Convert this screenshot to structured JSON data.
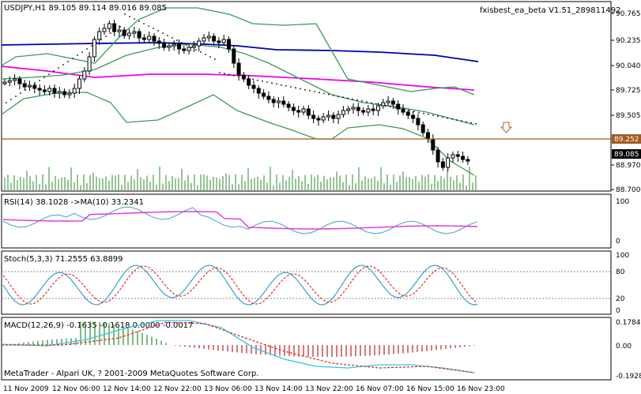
{
  "header": {
    "symbol_info": "USDJPY,H1  89.105 89.114 89.016 89.085",
    "ea_name": "fxisbest_ea_beta V1.51_289811492"
  },
  "price_axis": [
    "90.765",
    "90.235",
    "90.040",
    "89.725",
    "89.505",
    "89.252",
    "89.085",
    "88.970",
    "88.700"
  ],
  "marker_labels": {
    "hline": "89.252",
    "current": "89.085"
  },
  "rsi": {
    "label": "RSI(14) 38.1028   ->MA(10) 33.2341",
    "scale": [
      "100",
      "0"
    ]
  },
  "stoch": {
    "label": "Stoch(5,3,3) 71.2555 63.8899",
    "scale": [
      "100",
      "80",
      "20",
      "0"
    ]
  },
  "macd": {
    "label": "MACD(12,26,9) -0.1635 -0.1618 0.0000 -0.0017",
    "scale": [
      "0.1784",
      "0.00",
      "-0.1928"
    ]
  },
  "footer": {
    "copyright": "MetaTrader - Alpari UK, ? 2001-2009 MetaQuotes Software Corp."
  },
  "time_axis": [
    "11 Nov 2009",
    "12 Nov 06:00",
    "12 Nov 14:00",
    "12 Nov 22:00",
    "13 Nov 06:00",
    "13 Nov 14:00",
    "13 Nov 22:00",
    "16 Nov 07:00",
    "16 Nov 15:00",
    "16 Nov 23:00"
  ],
  "colors": {
    "background": "#ffffff",
    "grid": "#000000",
    "ma_slow": "#0000aa",
    "ma_mid": "#ee00ee",
    "bollinger": "#3a9a5a",
    "hline": "#a05a20",
    "volume": "#2e8b2e",
    "rsi": "#5fb0d0",
    "rsi_ma": "#dd33dd",
    "stoch_main": "#3aa0c8",
    "stoch_signal": "#dd2222",
    "macd_pos": "#2e8b2e",
    "macd_neg": "#bb2222",
    "macd_line": "#30c8e8",
    "macd_signal": "#dd2222"
  }
}
